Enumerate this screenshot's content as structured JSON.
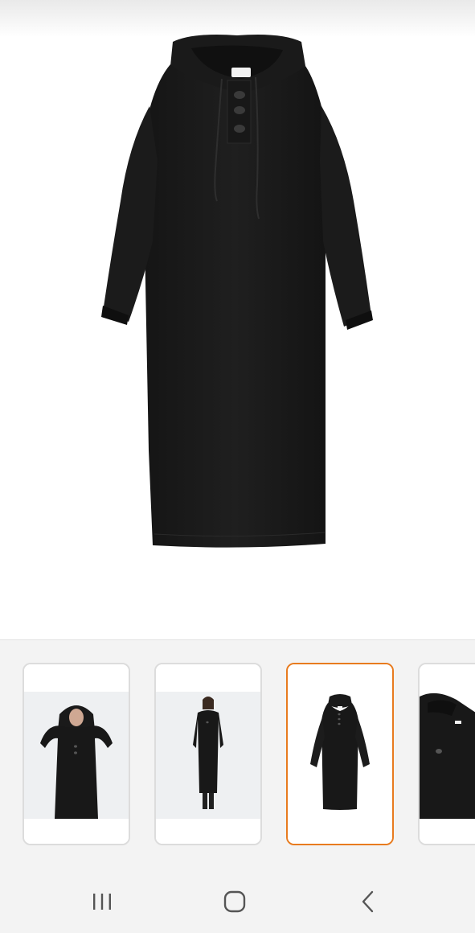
{
  "product": {
    "image_icon": "black-hooded-knit-maxi-dress"
  },
  "gallery": {
    "selected_index": 2,
    "accent_color": "#e87b1f",
    "thumbnails": [
      {
        "icon": "model-hood-up-photo"
      },
      {
        "icon": "model-full-length-photo"
      },
      {
        "icon": "product-flat-photo"
      },
      {
        "icon": "product-detail-closeup-photo"
      }
    ]
  },
  "system_nav": {
    "recents_icon": "recent-apps-icon",
    "home_icon": "home-icon",
    "back_icon": "back-icon"
  }
}
